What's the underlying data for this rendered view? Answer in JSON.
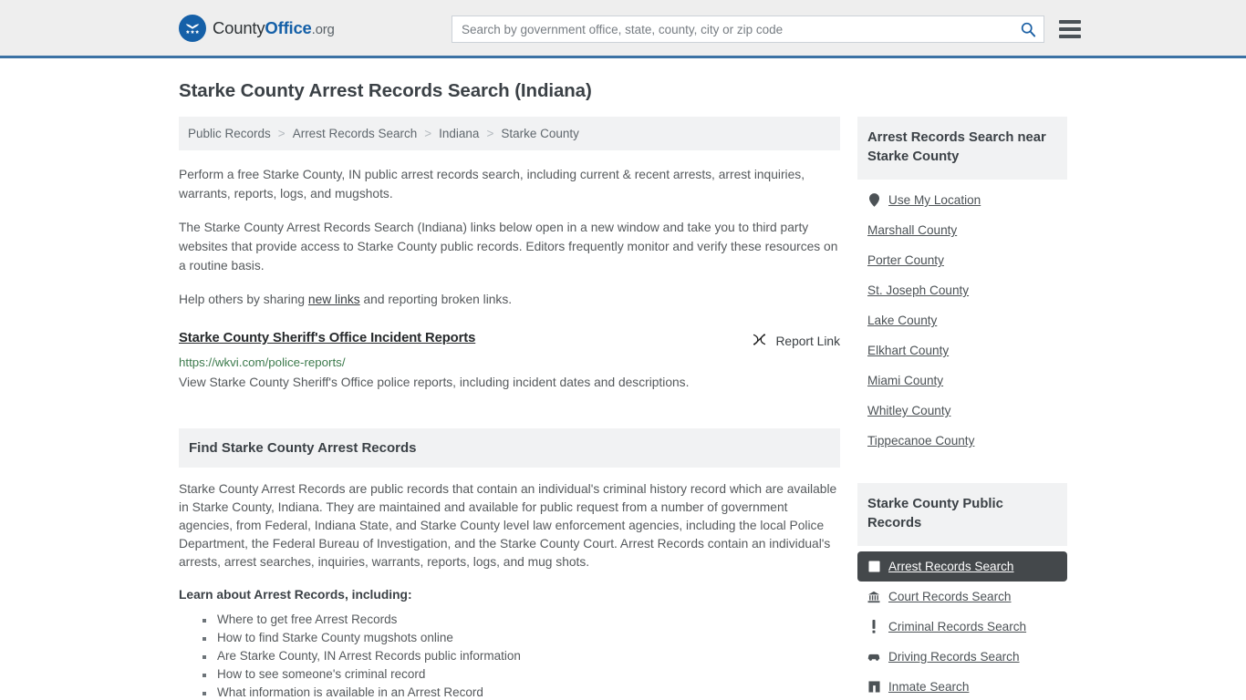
{
  "header": {
    "logo": {
      "icon": "eagle-shield-icon",
      "part1": "County",
      "part2": "Office",
      "part3": ".org"
    },
    "search": {
      "placeholder": "Search by government office, state, county, city or zip code",
      "value": "",
      "search_icon": "search-icon"
    },
    "menu_icon": "hamburger-menu-icon"
  },
  "page": {
    "title": "Starke County Arrest Records Search (Indiana)"
  },
  "breadcrumb": {
    "items": [
      {
        "label": "Public Records"
      },
      {
        "label": "Arrest Records Search"
      },
      {
        "label": "Indiana"
      },
      {
        "label": "Starke County"
      }
    ],
    "separator": ">"
  },
  "intro": {
    "p1": "Perform a free Starke County, IN public arrest records search, including current & recent arrests, arrest inquiries, warrants, reports, logs, and mugshots.",
    "p2": "The Starke County Arrest Records Search (Indiana) links below open in a new window and take you to third party websites that provide access to Starke County public records. Editors frequently monitor and verify these resources on a routine basis.",
    "p3_before": "Help others by sharing ",
    "p3_link": "new links",
    "p3_after": " and reporting broken links."
  },
  "result": {
    "title": "Starke County Sheriff's Office Incident Reports",
    "report_label": "Report Link",
    "report_icon": "broken-link-icon",
    "url": "https://wkvi.com/police-reports/",
    "description": "View Starke County Sheriff's Office police reports, including incident dates and descriptions."
  },
  "find_section": {
    "heading": "Find Starke County Arrest Records",
    "body": "Starke County Arrest Records are public records that contain an individual's criminal history record which are available in Starke County, Indiana. They are maintained and available for public request from a number of government agencies, from Federal, Indiana State, and Starke County level law enforcement agencies, including the local Police Department, the Federal Bureau of Investigation, and the Starke County Court. Arrest Records contain an individual's arrests, arrest searches, inquiries, warrants, reports, logs, and mug shots.",
    "learn_heading": "Learn about Arrest Records, including:",
    "learn_items": [
      "Where to get free Arrest Records",
      "How to find Starke County mugshots online",
      "Are Starke County, IN Arrest Records public information",
      "How to see someone's criminal record",
      "What information is available in an Arrest Record"
    ]
  },
  "sidebar": {
    "nearby": {
      "heading": "Arrest Records Search near Starke County",
      "items": [
        {
          "label": "Use My Location",
          "icon": "map-pin-icon"
        },
        {
          "label": "Marshall County",
          "icon": ""
        },
        {
          "label": "Porter County",
          "icon": ""
        },
        {
          "label": "St. Joseph County",
          "icon": ""
        },
        {
          "label": "Lake County",
          "icon": ""
        },
        {
          "label": "Elkhart County",
          "icon": ""
        },
        {
          "label": "Miami County",
          "icon": ""
        },
        {
          "label": "Whitley County",
          "icon": ""
        },
        {
          "label": "Tippecanoe County",
          "icon": ""
        }
      ]
    },
    "public_records": {
      "heading": "Starke County Public Records",
      "items": [
        {
          "label": "Arrest Records Search",
          "icon": "file-square-icon",
          "active": true
        },
        {
          "label": "Court Records Search",
          "icon": "courthouse-icon",
          "active": false
        },
        {
          "label": "Criminal Records Search",
          "icon": "exclamation-icon",
          "active": false
        },
        {
          "label": "Driving Records Search",
          "icon": "car-icon",
          "active": false
        },
        {
          "label": "Inmate Search",
          "icon": "jail-building-icon",
          "active": false
        }
      ]
    }
  },
  "colors": {
    "brand_blue": "#1560a8",
    "header_bg": "#eeeeee",
    "header_border": "#3b72a4",
    "panel_bg": "#f1f2f3",
    "active_bg": "#44484b",
    "url_green": "#3c7a4c",
    "text": "#55595c"
  }
}
